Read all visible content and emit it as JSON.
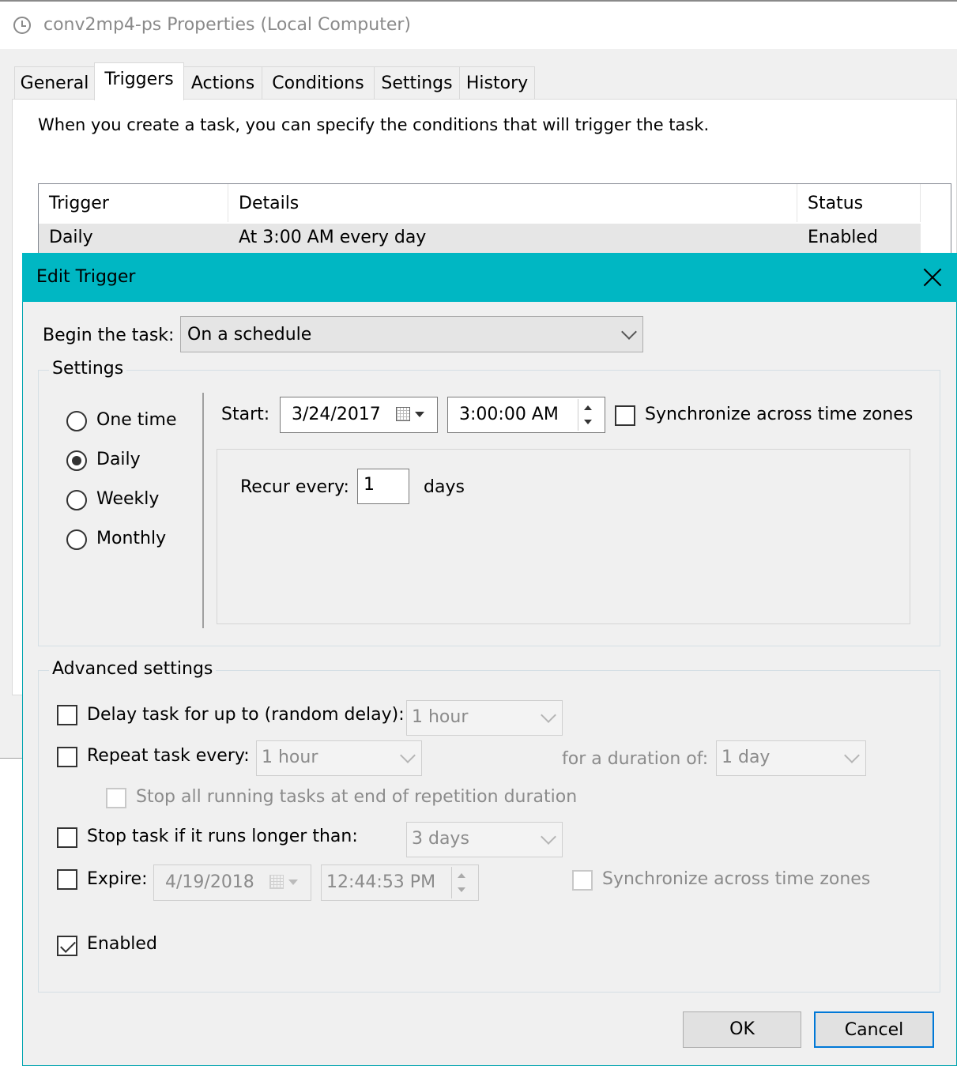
{
  "back_window": {
    "title": "conv2mp4-ps Properties (Local Computer)",
    "tabs": [
      "General",
      "Triggers",
      "Actions",
      "Conditions",
      "Settings",
      "History"
    ],
    "active_tab": "Triggers",
    "description": "When you create a task, you can specify the conditions that will trigger the task.",
    "table": {
      "headers": [
        "Trigger",
        "Details",
        "Status"
      ],
      "rows": [
        [
          "Daily",
          "At 3:00 AM every day",
          "Enabled"
        ]
      ]
    }
  },
  "dialog": {
    "title": "Edit Trigger",
    "begin_label": "Begin the task:",
    "begin_value": "On a schedule",
    "settings": {
      "title": "Settings",
      "options": [
        "One time",
        "Daily",
        "Weekly",
        "Monthly"
      ],
      "selected": "Daily",
      "start_label": "Start:",
      "start_date": "3/24/2017",
      "start_time": "3:00:00 AM",
      "sync_label": "Synchronize across time zones",
      "recur_label": "Recur every:",
      "recur_value": "1",
      "recur_unit": "days"
    },
    "advanced": {
      "title": "Advanced settings",
      "delay_label": "Delay task for up to (random delay):",
      "delay_value": "1 hour",
      "repeat_label": "Repeat task every:",
      "repeat_value": "1 hour",
      "duration_label": "for a duration of:",
      "duration_value": "1 day",
      "stop_all_label": "Stop all running tasks at end of repetition duration",
      "stop_longer_label": "Stop task if it runs longer than:",
      "stop_longer_value": "3 days",
      "expire_label": "Expire:",
      "expire_date": "4/19/2018",
      "expire_time": "12:44:53 PM",
      "expire_sync_label": "Synchronize across time zones",
      "enabled_label": "Enabled",
      "enabled_checked": true
    },
    "ok_label": "OK",
    "cancel_label": "Cancel"
  }
}
